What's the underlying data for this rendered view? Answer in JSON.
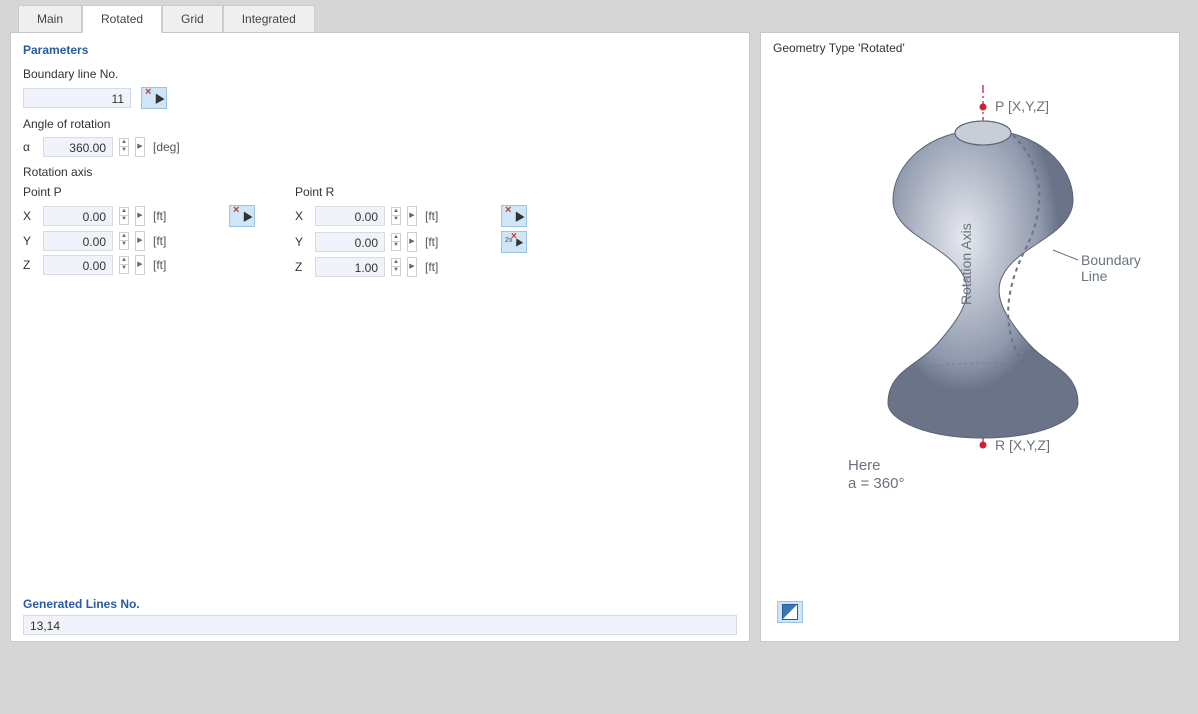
{
  "tabs": {
    "main": "Main",
    "rotated": "Rotated",
    "grid": "Grid",
    "integrated": "Integrated"
  },
  "left": {
    "title": "Parameters",
    "boundary_label": "Boundary line No.",
    "boundary_value": "11",
    "angle_label": "Angle of rotation",
    "alpha_symbol": "α",
    "alpha_value": "360.00",
    "alpha_unit": "[deg]",
    "rotation_axis_label": "Rotation axis",
    "pointP_label": "Point P",
    "pointR_label": "Point R",
    "x": "X",
    "y": "Y",
    "z": "Z",
    "px": "0.00",
    "py": "0.00",
    "pz": "0.00",
    "rx": "0.00",
    "ry": "0.00",
    "rz": "1.00",
    "ft": "[ft]",
    "gen_title": "Generated Lines No.",
    "gen_value": "13,14"
  },
  "right": {
    "title": "Geometry Type 'Rotated'",
    "p_label": "P [X,Y,Z]",
    "r_label": "R [X,Y,Z]",
    "axis_label": "Rotation Axis",
    "boundary_label": "Boundary\nLine",
    "alpha": "α",
    "here": "Here",
    "alpha_eq": "a = 360°"
  }
}
